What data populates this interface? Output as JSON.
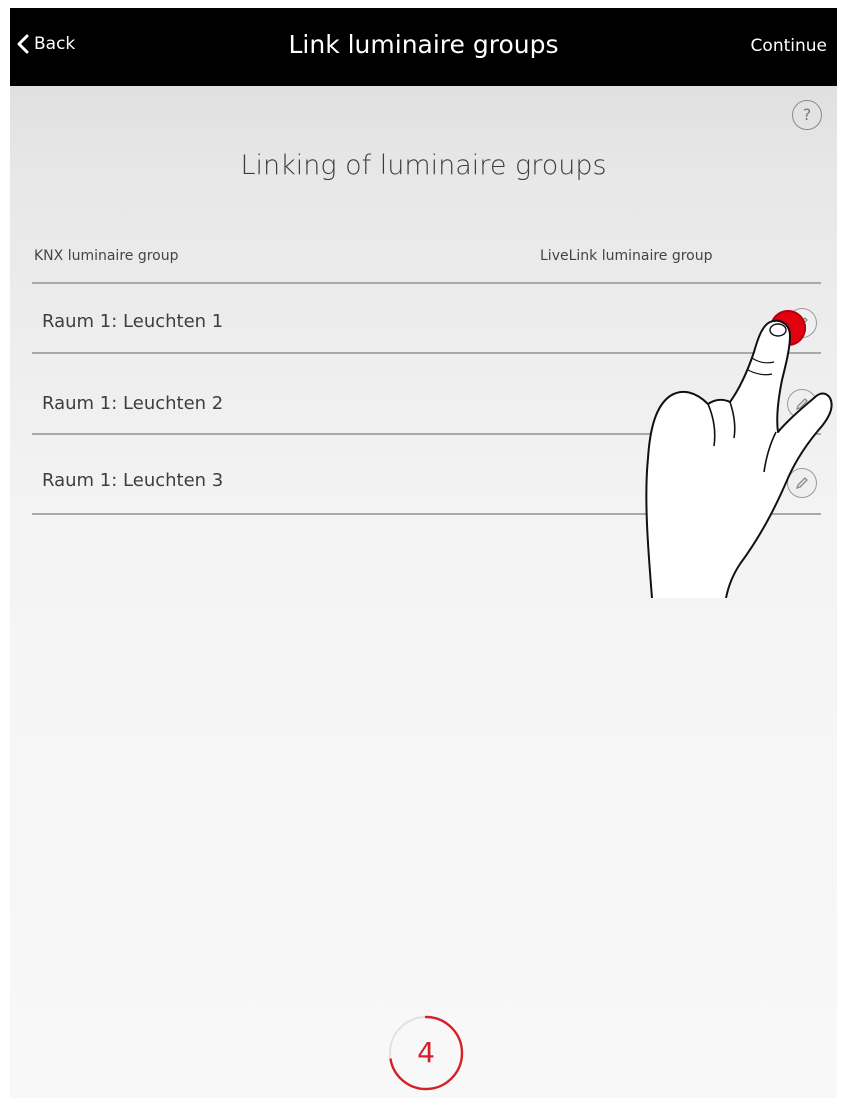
{
  "navbar": {
    "back_label": "Back",
    "title": "Link luminaire groups",
    "continue_label": "Continue"
  },
  "help": {
    "label": "?"
  },
  "heading": "Linking of luminaire groups",
  "columns": {
    "knx": "KNX luminaire group",
    "livelink": "LiveLink luminaire group"
  },
  "rows": [
    {
      "label": "Raum 1: Leuchten 1",
      "action_icon": "edit-icon",
      "state": "tapped"
    },
    {
      "label": "Raum 1: Leuchten 2",
      "action_icon": "edit-icon"
    },
    {
      "label": "Raum 1: Leuchten 3",
      "action_icon": "edit-icon"
    }
  ],
  "step": {
    "number": "4",
    "progress_fraction": 0.72
  },
  "colors": {
    "accent": "#e3000f",
    "navbar_bg": "#000000",
    "navbar_text": "#ffffff",
    "text": "#3e3e3e",
    "divider": "#a9a9a9"
  }
}
